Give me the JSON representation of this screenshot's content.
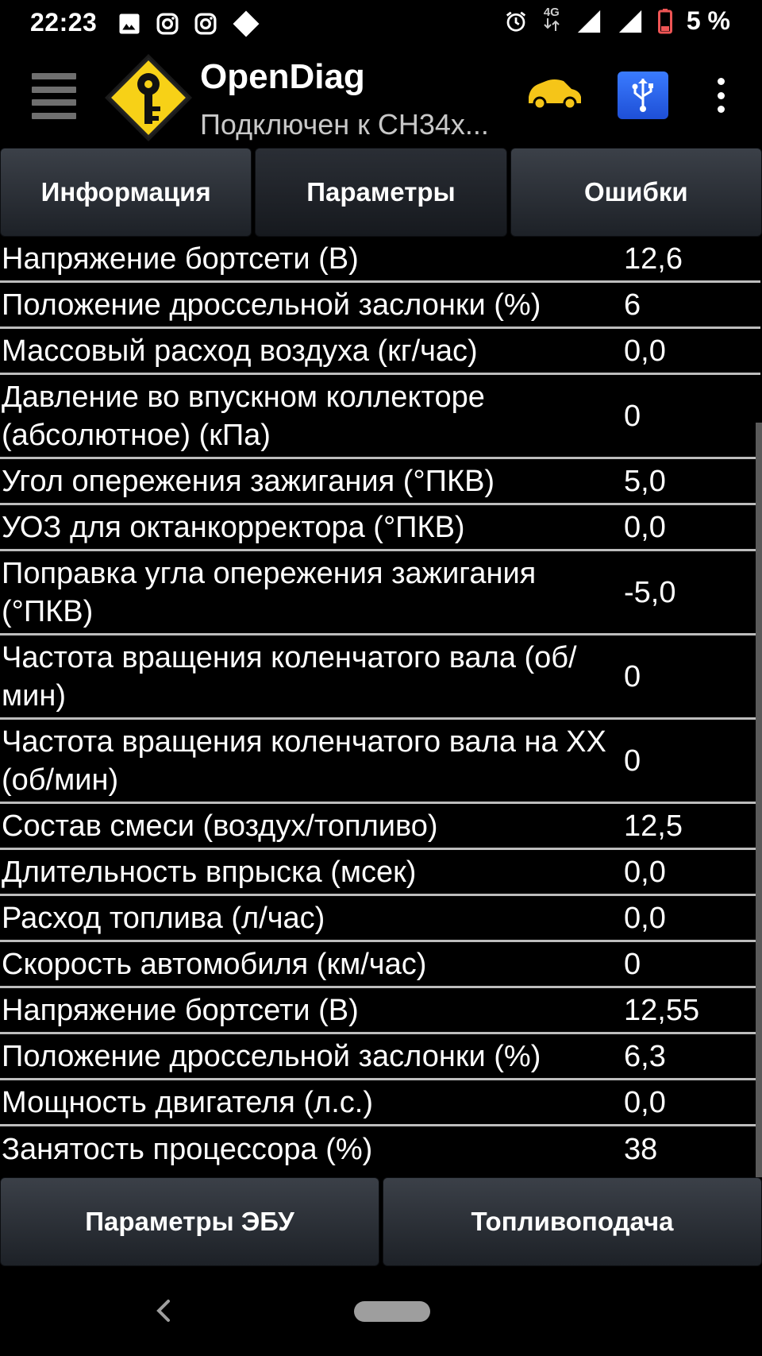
{
  "status_bar": {
    "time": "22:23",
    "network_label": "4G",
    "battery": "5 %"
  },
  "app": {
    "title": "OpenDiag",
    "subtitle": "Подключен к CH34x..."
  },
  "tabs": [
    {
      "label": "Информация"
    },
    {
      "label": "Параметры"
    },
    {
      "label": "Ошибки"
    }
  ],
  "params": [
    {
      "name": "Напряжение бортсети (В)",
      "value": "12,6"
    },
    {
      "name": "Положение дроссельной заслонки (%)",
      "value": "6"
    },
    {
      "name": "Массовый расход воздуха (кг/час)",
      "value": "0,0"
    },
    {
      "name": "Давление во впускном коллекторе (абсолютное) (кПа)",
      "value": "0"
    },
    {
      "name": "Угол опережения зажигания (°ПКВ)",
      "value": "5,0"
    },
    {
      "name": "УОЗ для октанкорректора (°ПКВ)",
      "value": "0,0"
    },
    {
      "name": "Поправка угла опережения зажигания (°ПКВ)",
      "value": "-5,0"
    },
    {
      "name": "Частота вращения коленчатого вала (об/мин)",
      "value": "0"
    },
    {
      "name": "Частота вращения коленчатого вала на ХХ (об/мин)",
      "value": "0"
    },
    {
      "name": "Состав смеси (воздух/топливо)",
      "value": "12,5"
    },
    {
      "name": "Длительность впрыска (мсек)",
      "value": "0,0"
    },
    {
      "name": "Расход топлива (л/час)",
      "value": "0,0"
    },
    {
      "name": "Скорость автомобиля (км/час)",
      "value": "0"
    },
    {
      "name": "Напряжение бортсети (В)",
      "value": "12,55"
    },
    {
      "name": "Положение дроссельной заслонки (%)",
      "value": "6,3"
    },
    {
      "name": "Мощность двигателя (л.с.)",
      "value": "0,0"
    },
    {
      "name": "Занятость процессора (%)",
      "value": "38"
    }
  ],
  "bottom_buttons": [
    {
      "label": "Параметры ЭБУ"
    },
    {
      "label": "Топливоподача"
    }
  ],
  "colors": {
    "car_icon": "#f5c518",
    "usb_button": "#2b63ee",
    "logo_sign": "#f7d117"
  }
}
